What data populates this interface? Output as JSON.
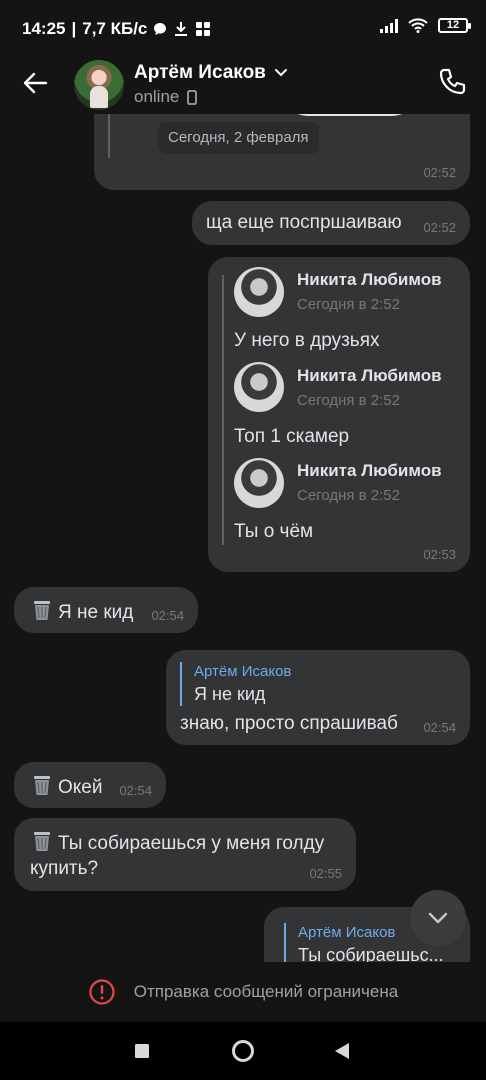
{
  "status_bar": {
    "time": "14:25",
    "speed": "7,7 КБ/с",
    "battery": "12"
  },
  "header": {
    "name": "Артём Исаков",
    "status": "online"
  },
  "date_pill": "Сегодня, 2 февраля",
  "messages": {
    "m0_time": "02:52",
    "m1_text": "ща еще поспршаиваю",
    "m1_time": "02:52",
    "m2": {
      "items": [
        {
          "name": "Никита Любимов",
          "date": "Сегодня в 2:52",
          "text": "У него в друзьях"
        },
        {
          "name": "Никита Любимов",
          "date": "Сегодня в 2:52",
          "text": "Топ 1 скамер"
        },
        {
          "name": "Никита Любимов",
          "date": "Сегодня в 2:52",
          "text": "Ты о чём"
        }
      ],
      "time": "02:53"
    },
    "m3_text": "Я не кид",
    "m3_time": "02:54",
    "m4": {
      "reply_name": "Артём Исаков",
      "reply_text": "Я не кид",
      "text": "знаю, просто спрашиваб",
      "time": "02:54"
    },
    "m5_text": "Окей",
    "m5_time": "02:54",
    "m6_line1": "Ты собираешься у меня голду",
    "m6_line2": "купить?",
    "m6_time": "02:55",
    "m7": {
      "reply_name": "Артём Исаков",
      "reply_text": "Ты собираешьс..."
    }
  },
  "restriction": "Отправка сообщений ограничена",
  "colors": {
    "background": "#141414",
    "bubble": "#333436",
    "accent": "#71aaeb",
    "warning": "#e64646"
  },
  "icons": [
    "back-arrow-icon",
    "chevron-down-icon",
    "phone-icon",
    "device-icon",
    "trash-emoji-icon",
    "chevron-down-icon",
    "warning-icon"
  ]
}
